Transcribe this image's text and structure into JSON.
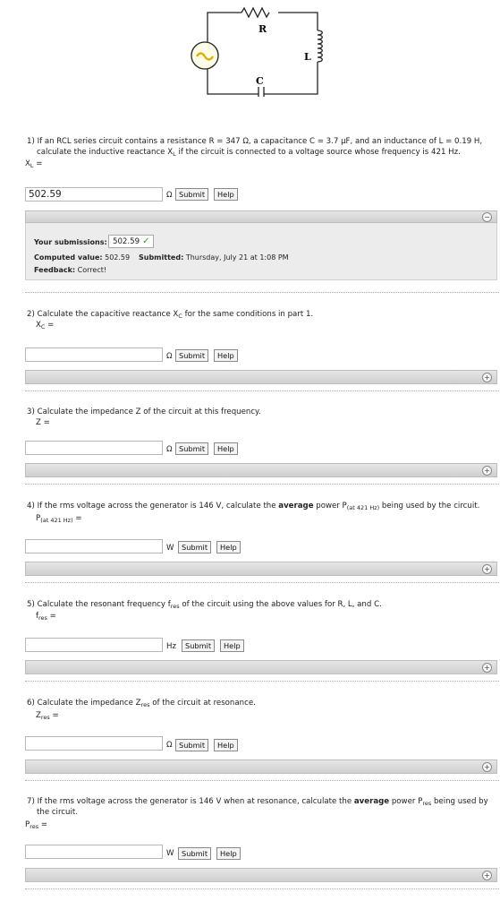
{
  "circuit": {
    "R": "R",
    "L": "L",
    "C": "C"
  },
  "questions": [
    {
      "num": "1)",
      "line1": "If an RCL series circuit contains a resistance R = 347 Ω, a capacitance C = 3.7 μF, and an inductance of L = 0.19 H,",
      "line2a": "calculate the inductive reactance X",
      "line2sub": "L",
      "line2b": " if the circuit is connected to a voltage source whose frequency is 421 Hz.",
      "var": "X",
      "var_sub": "L",
      "var_eq": " =",
      "value": "502.59",
      "unit": "Ω",
      "submit": "Submit",
      "help": "Help",
      "feedback": {
        "submissions_label": "Your submissions:",
        "submission_value": "502.59",
        "computed_label": "Computed value:",
        "computed_value": "502.59",
        "submitted_label": "Submitted:",
        "submitted_value": "Thursday, July 21 at 1:08 PM",
        "feedback_label": "Feedback:",
        "feedback_value": "Correct!"
      }
    },
    {
      "num": "2)",
      "text_a": "Calculate the capacitive reactance X",
      "text_sub": "C",
      "text_b": " for the same conditions in part 1.",
      "var": "X",
      "var_sub": "C",
      "var_eq": " =",
      "value": "",
      "unit": "Ω",
      "submit": "Submit",
      "help": "Help"
    },
    {
      "num": "3)",
      "text_a": "Calculate the impedance Z of the circuit at this frequency.",
      "var": "Z =",
      "value": "",
      "unit": "Ω",
      "submit": "Submit",
      "help": "Help"
    },
    {
      "num": "4)",
      "text_a": "If the rms voltage across the generator is 146 V, calculate the ",
      "text_bold": "average",
      "text_b": " power P",
      "text_sub": "(at 421 Hz)",
      "text_c": " being used by the circuit.",
      "var": "P",
      "var_sub": "(at 421 Hz)",
      "var_eq": " =",
      "value": "",
      "unit": "W",
      "submit": "Submit",
      "help": "Help"
    },
    {
      "num": "5)",
      "text_a": "Calculate the resonant frequency f",
      "text_sub": "res",
      "text_b": " of the circuit using the above values for R, L, and C.",
      "var": "f",
      "var_sub": "res",
      "var_eq": " =",
      "value": "",
      "unit": "Hz",
      "submit": "Submit",
      "help": "Help"
    },
    {
      "num": "6)",
      "text_a": "Calculate the impedance Z",
      "text_sub": "res",
      "text_b": " of the circuit at resonance.",
      "var": "Z",
      "var_sub": "res",
      "var_eq": " =",
      "value": "",
      "unit": "Ω",
      "submit": "Submit",
      "help": "Help"
    },
    {
      "num": "7)",
      "text_a": "If the rms voltage across the generator is 146 V when at resonance, calculate the ",
      "text_bold": "average",
      "text_b": " power P",
      "text_sub": "res",
      "text_c": " being used by",
      "line2": "the circuit.",
      "var": "P",
      "var_sub": "res",
      "var_eq": " =",
      "value": "",
      "unit": "W",
      "submit": "Submit",
      "help": "Help"
    }
  ],
  "toggle_open": "−",
  "toggle_closed": "+",
  "colors": {
    "source_fill": "#fdfde8",
    "source_sine": "#e0b000",
    "check": "#2a9a2a"
  }
}
